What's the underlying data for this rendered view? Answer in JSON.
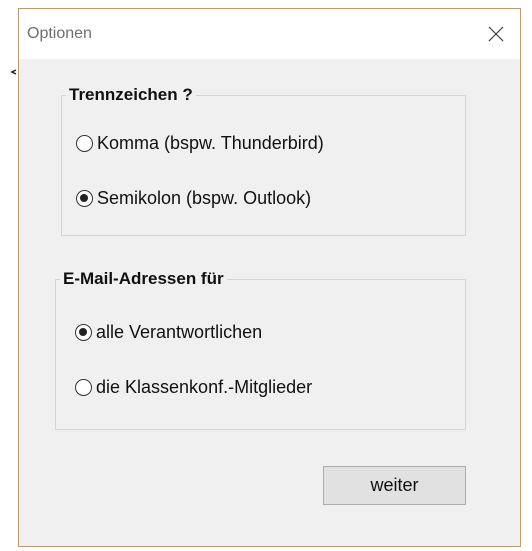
{
  "window": {
    "title": "Optionen",
    "border_color": "#d9944a"
  },
  "groups": [
    {
      "legend": "Trennzeichen ?",
      "options": [
        {
          "label": "Komma (bspw. Thunderbird)",
          "checked": false
        },
        {
          "label": "Semikolon (bspw. Outlook)",
          "checked": true
        }
      ]
    },
    {
      "legend": "E-Mail-Adressen für",
      "options": [
        {
          "label": "alle Verantwortlichen",
          "checked": true
        },
        {
          "label": "die Klassenkonf.-Mitglieder",
          "checked": false
        }
      ]
    }
  ],
  "buttons": {
    "continue_label": "weiter"
  },
  "icons": {
    "close": "close-icon"
  }
}
